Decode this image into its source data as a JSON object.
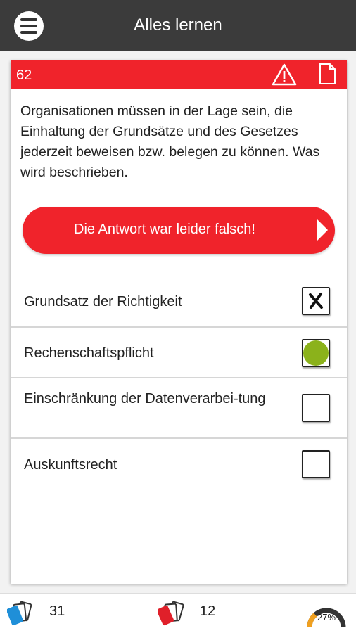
{
  "header": {
    "title": "Alles lernen",
    "menu_icon": "hamburger-menu-icon"
  },
  "card": {
    "question_number": "62",
    "header_icons": [
      "warning-triangle-icon",
      "document-icon"
    ],
    "question_text": "Organisationen müssen in der Lage sein, die Einhaltung der Grundsätze und des Gesetzes jederzeit beweisen bzw. belegen zu können. Was wird beschrieben.",
    "result_label": "Die Antwort war leider falsch!",
    "accent_color": "#f0232b",
    "correct_color": "#8bb21b",
    "answers": [
      {
        "text": "Grundsatz der Richtigkeit",
        "state": "selected-wrong"
      },
      {
        "text": "Rechenschaftspflicht",
        "state": "correct"
      },
      {
        "text": "Einschränkung der Datenverarbei-tung",
        "state": "unchecked"
      },
      {
        "text": "Auskunftsrecht",
        "state": "unchecked"
      }
    ]
  },
  "footer": {
    "blue_cards_count": "31",
    "red_cards_count": "12",
    "progress_label": "27%",
    "progress_value": 0.27,
    "icons": [
      "blue-cards-icon",
      "red-cards-icon",
      "progress-gauge-icon"
    ]
  }
}
